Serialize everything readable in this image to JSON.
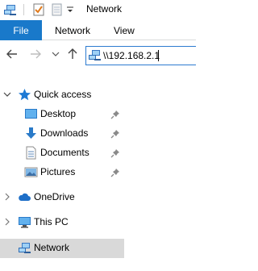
{
  "window": {
    "title": "Network"
  },
  "ribbon": {
    "tabs": [
      {
        "label": "File"
      },
      {
        "label": "Network"
      },
      {
        "label": "View"
      }
    ]
  },
  "address": {
    "value": "\\\\192.168.2.1"
  },
  "nav": {
    "quick_access": "Quick access",
    "items": [
      {
        "label": "Desktop",
        "icon": "desktop-icon"
      },
      {
        "label": "Downloads",
        "icon": "downloads-icon"
      },
      {
        "label": "Documents",
        "icon": "documents-icon"
      },
      {
        "label": "Pictures",
        "icon": "pictures-icon"
      }
    ],
    "onedrive": "OneDrive",
    "this_pc": "This PC",
    "network": "Network"
  },
  "colors": {
    "accent": "#1979ca",
    "selected": "#d9d9d9",
    "address_border": "#2c7bd0"
  }
}
